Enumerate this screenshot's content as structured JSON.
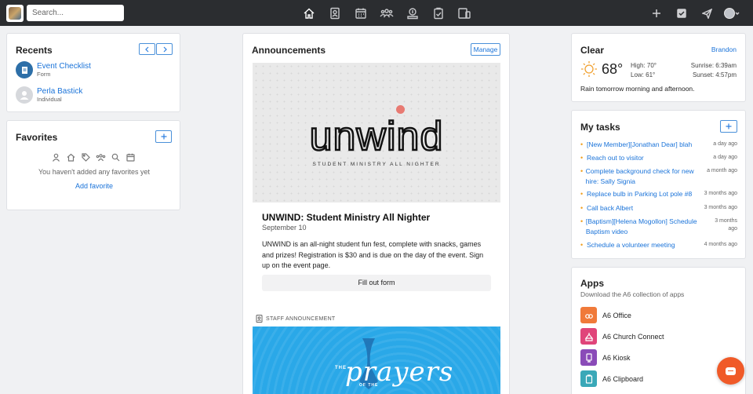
{
  "topbar": {
    "search_placeholder": "Search...",
    "nav_icons": [
      "home-icon",
      "profile-icon",
      "calendar-icon",
      "groups-icon",
      "giving-icon",
      "checklist-icon",
      "devices-icon"
    ],
    "right_icons": [
      "plus-icon",
      "check-square-icon",
      "send-icon",
      "user-avatar-icon"
    ]
  },
  "recents": {
    "title": "Recents",
    "items": [
      {
        "name": "Event Checklist",
        "sub": "Form"
      },
      {
        "name": "Perla Bastick",
        "sub": "Individual"
      }
    ]
  },
  "favorites": {
    "title": "Favorites",
    "empty_text": "You haven't added any favorites yet",
    "add_link": "Add favorite"
  },
  "announcements": {
    "title": "Announcements",
    "manage_label": "Manage",
    "banner_word": "unwind",
    "banner_tag": "STUDENT MINISTRY ALL NIGHTER",
    "event_title": "UNWIND: Student Ministry All Nighter",
    "event_date": "September 10",
    "event_desc": "UNWIND is an all-night student fun fest, complete with snacks, games and prizes! Registration is $30 and is due on the day of the event. Sign up on the event page.",
    "form_button": "Fill out form",
    "staff_label": "STAFF ANNOUNCEMENT",
    "banner2_the": "THE",
    "banner2_word": "prayers",
    "banner2_of_the": "OF THE"
  },
  "weather": {
    "title": "Clear",
    "user": "Brandon",
    "temp": "68°",
    "high": "High: 70°",
    "low": "Low: 61°",
    "sunrise": "Sunrise: 6:39am",
    "sunset": "Sunset: 4:57pm",
    "note": "Rain tomorrow morning and afternoon."
  },
  "tasks": {
    "title": "My tasks",
    "items": [
      {
        "text": "[New Member][Jonathan Dear] blah",
        "time": "a day ago"
      },
      {
        "text": "Reach out to visitor",
        "time": "a day ago"
      },
      {
        "text": "Complete background check for new hire: Sally Signia",
        "time": "a month ago"
      },
      {
        "text": "Replace bulb in Parking Lot pole #8",
        "time": "3 months ago"
      },
      {
        "text": "Call back Albert",
        "time": "3 months ago"
      },
      {
        "text": "[Baptism][Helena Mogollon] Schedule Baptism video",
        "time": "3 months ago"
      },
      {
        "text": "Schedule a volunteer meeting",
        "time": "4 months ago"
      }
    ]
  },
  "apps": {
    "title": "Apps",
    "subtitle": "Download the A6 collection of apps",
    "items": [
      {
        "name": "A6 Office",
        "color": "#f07a3a"
      },
      {
        "name": "A6 Church Connect",
        "color": "#e0457a"
      },
      {
        "name": "A6 Kiosk",
        "color": "#8a4bb8"
      },
      {
        "name": "A6 Clipboard",
        "color": "#3aa8b8"
      }
    ]
  }
}
